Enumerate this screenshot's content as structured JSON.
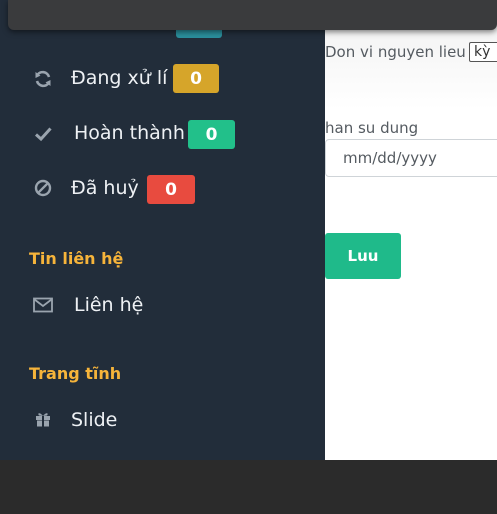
{
  "sidebar": {
    "top_badge": "",
    "items": [
      {
        "label": "Đang xử lí",
        "icon": "refresh-icon",
        "badge": "0"
      },
      {
        "label": "Hoàn thành",
        "icon": "check-icon",
        "badge": "0"
      },
      {
        "label": "Đã huỷ",
        "icon": "ban-icon",
        "badge": "0"
      }
    ],
    "sections": [
      {
        "header": "Tin liên hệ",
        "item": {
          "label": "Liên hệ",
          "icon": "envelope-icon"
        }
      },
      {
        "header": "Trang tĩnh",
        "item": {
          "label": "Slide",
          "icon": "gift-icon"
        }
      }
    ]
  },
  "form": {
    "unit_label": "Don vi nguyen lieu",
    "unit_value": "kỳ",
    "expiry_label": "han su dung",
    "expiry_placeholder": "mm/dd/yyyy",
    "save_label": "Luu"
  },
  "colors": {
    "sidebar_bg": "#222d3a",
    "header": "#f6b43a",
    "warning": "#d6a52a",
    "success": "#22c08a",
    "danger": "#e84b3f",
    "save": "#1fba8a"
  }
}
